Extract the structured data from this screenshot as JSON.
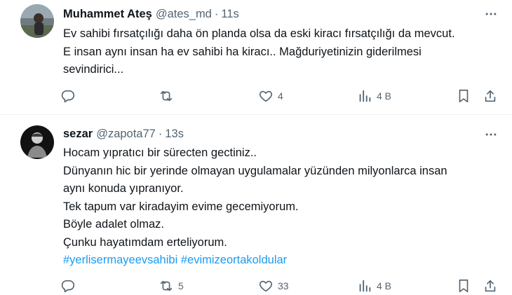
{
  "tweets": [
    {
      "author_name": "Muhammet Ateş",
      "handle": "@ates_md",
      "separator": "·",
      "time": "11s",
      "lines": [
        "Ev sahibi fırsatçılığı daha ön planda olsa da eski kiracı fırsatçılığı da mevcut.",
        "E insan aynı insan ha ev sahibi ha kiracı.. Mağduriyetinizin giderilmesi",
        "sevindirici..."
      ],
      "counts": {
        "reply": "",
        "retweet": "",
        "like": "4",
        "views": "4 B"
      }
    },
    {
      "author_name": "sezar",
      "handle": "@zapota77",
      "separator": "·",
      "time": "13s",
      "lines": [
        "Hocam yıpratıcı bir sürecten gectiniz..",
        "Dünyanın hic bir yerinde olmayan uygulamalar yüzünden milyonlarca insan",
        "aynı konuda yıpranıyor.",
        "Tek tapum var kiradayim evime gecemiyorum.",
        "Böyle adalet olmaz.",
        "Çunku hayatımdam erteliyorum."
      ],
      "hashtags": [
        "#yerlisermayeevsahibi",
        "#evimizeortakoldular"
      ],
      "counts": {
        "reply": "",
        "retweet": "5",
        "like": "33",
        "views": "4 B"
      }
    }
  ],
  "icons": [
    "more-icon",
    "reply-icon",
    "retweet-icon",
    "like-icon",
    "views-icon",
    "bookmark-icon",
    "share-icon"
  ]
}
